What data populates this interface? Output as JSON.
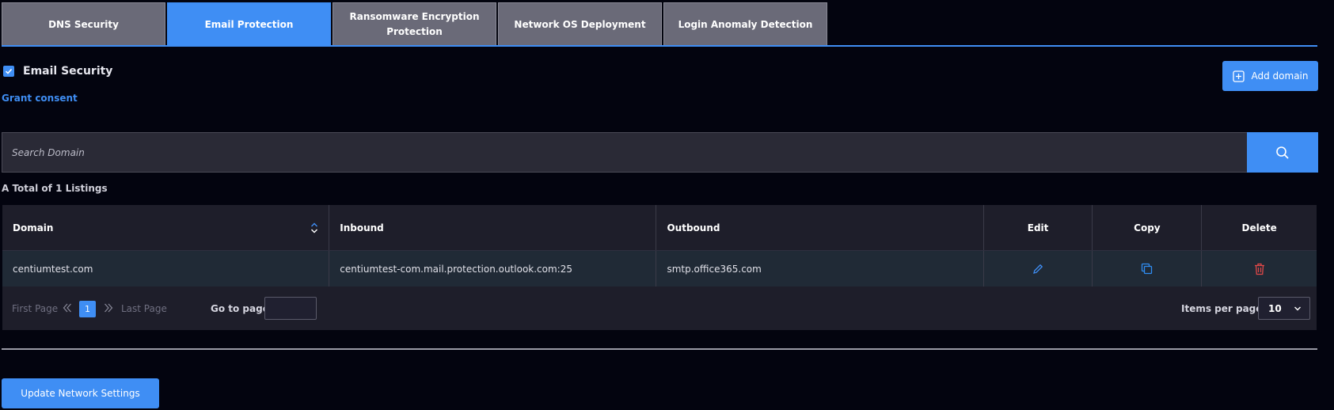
{
  "tabs": [
    {
      "label": "DNS Security",
      "active": false
    },
    {
      "label": "Email Protection",
      "active": true
    },
    {
      "label": "Ransomware Encryption Protection",
      "active": false
    },
    {
      "label": "Network OS Deployment",
      "active": false
    },
    {
      "label": "Login Anomaly Detection",
      "active": false
    }
  ],
  "email_security": {
    "label": "Email Security",
    "checked": true
  },
  "grant_consent": "Grant consent",
  "add_domain": {
    "label": "Add domain",
    "icon": "plus-square-icon"
  },
  "search": {
    "placeholder": "Search Domain",
    "value": "",
    "icon": "search-icon"
  },
  "total_listings": "A Total of 1 Listings",
  "table": {
    "headers": {
      "domain": "Domain",
      "inbound": "Inbound",
      "outbound": "Outbound",
      "edit": "Edit",
      "copy": "Copy",
      "delete": "Delete"
    },
    "rows": [
      {
        "domain": "centiumtest.com",
        "inbound": "centiumtest-com.mail.protection.outlook.com:25",
        "outbound": "smtp.office365.com"
      }
    ]
  },
  "pagination": {
    "first": "First Page",
    "last": "Last Page",
    "current_page": "1",
    "go_to_label": "Go to page:",
    "items_per_page_label": "Items per page:",
    "items_per_page": "10"
  },
  "update_button": "Update Network Settings",
  "colors": {
    "accent": "#3f8ef4",
    "background": "#03040f",
    "tab_inactive": "#6a6a78",
    "delete_red": "#e04848",
    "copy_blue": "#2f8df2"
  }
}
